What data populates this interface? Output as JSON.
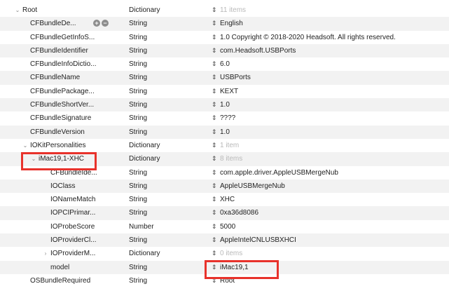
{
  "rows": [
    {
      "key": "Root",
      "disc": "⌄",
      "type": "Dictionary",
      "value": "11 items",
      "dim": true
    },
    {
      "key": "CFBundleDe...",
      "disc": "",
      "type": "String",
      "value": "English",
      "dim": false
    },
    {
      "key": "CFBundleGetInfoS...",
      "disc": "",
      "type": "String",
      "value": "1.0 Copyright © 2018-2020 Headsoft. All rights reserved.",
      "dim": false
    },
    {
      "key": "CFBundleIdentifier",
      "disc": "",
      "type": "String",
      "value": "com.Headsoft.USBPorts",
      "dim": false
    },
    {
      "key": "CFBundleInfoDictio...",
      "disc": "",
      "type": "String",
      "value": "6.0",
      "dim": false
    },
    {
      "key": "CFBundleName",
      "disc": "",
      "type": "String",
      "value": "USBPorts",
      "dim": false
    },
    {
      "key": "CFBundlePackage...",
      "disc": "",
      "type": "String",
      "value": "KEXT",
      "dim": false
    },
    {
      "key": "CFBundleShortVer...",
      "disc": "",
      "type": "String",
      "value": "1.0",
      "dim": false
    },
    {
      "key": "CFBundleSignature",
      "disc": "",
      "type": "String",
      "value": "????",
      "dim": false
    },
    {
      "key": "CFBundleVersion",
      "disc": "",
      "type": "String",
      "value": "1.0",
      "dim": false
    },
    {
      "key": "IOKitPersonalities",
      "disc": "⌄",
      "type": "Dictionary",
      "value": "1 item",
      "dim": true
    },
    {
      "key": "iMac19,1-XHC",
      "disc": "⌄",
      "type": "Dictionary",
      "value": "8 items",
      "dim": true
    },
    {
      "key": "CFBundleIde...",
      "disc": "",
      "type": "String",
      "value": "com.apple.driver.AppleUSBMergeNub",
      "dim": false
    },
    {
      "key": "IOClass",
      "disc": "",
      "type": "String",
      "value": "AppleUSBMergeNub",
      "dim": false
    },
    {
      "key": "IONameMatch",
      "disc": "",
      "type": "String",
      "value": "XHC",
      "dim": false
    },
    {
      "key": "IOPCIPrimar...",
      "disc": "",
      "type": "String",
      "value": "0xa36d8086",
      "dim": false
    },
    {
      "key": "IOProbeScore",
      "disc": "",
      "type": "Number",
      "value": "5000",
      "dim": false
    },
    {
      "key": "IOProviderCl...",
      "disc": "",
      "type": "String",
      "value": "AppleIntelCNLUSBXHCI",
      "dim": false
    },
    {
      "key": "IOProviderM...",
      "disc": "›",
      "type": "Dictionary",
      "value": "0 items",
      "dim": true
    },
    {
      "key": "model",
      "disc": "",
      "type": "String",
      "value": "iMac19,1",
      "dim": false
    },
    {
      "key": "OSBundleRequired",
      "disc": "",
      "type": "String",
      "value": "Root",
      "dim": false
    }
  ],
  "stepper_glyph": "⇕",
  "add_glyph": "+",
  "remove_glyph": "−",
  "highlight_color": "#e8322b"
}
